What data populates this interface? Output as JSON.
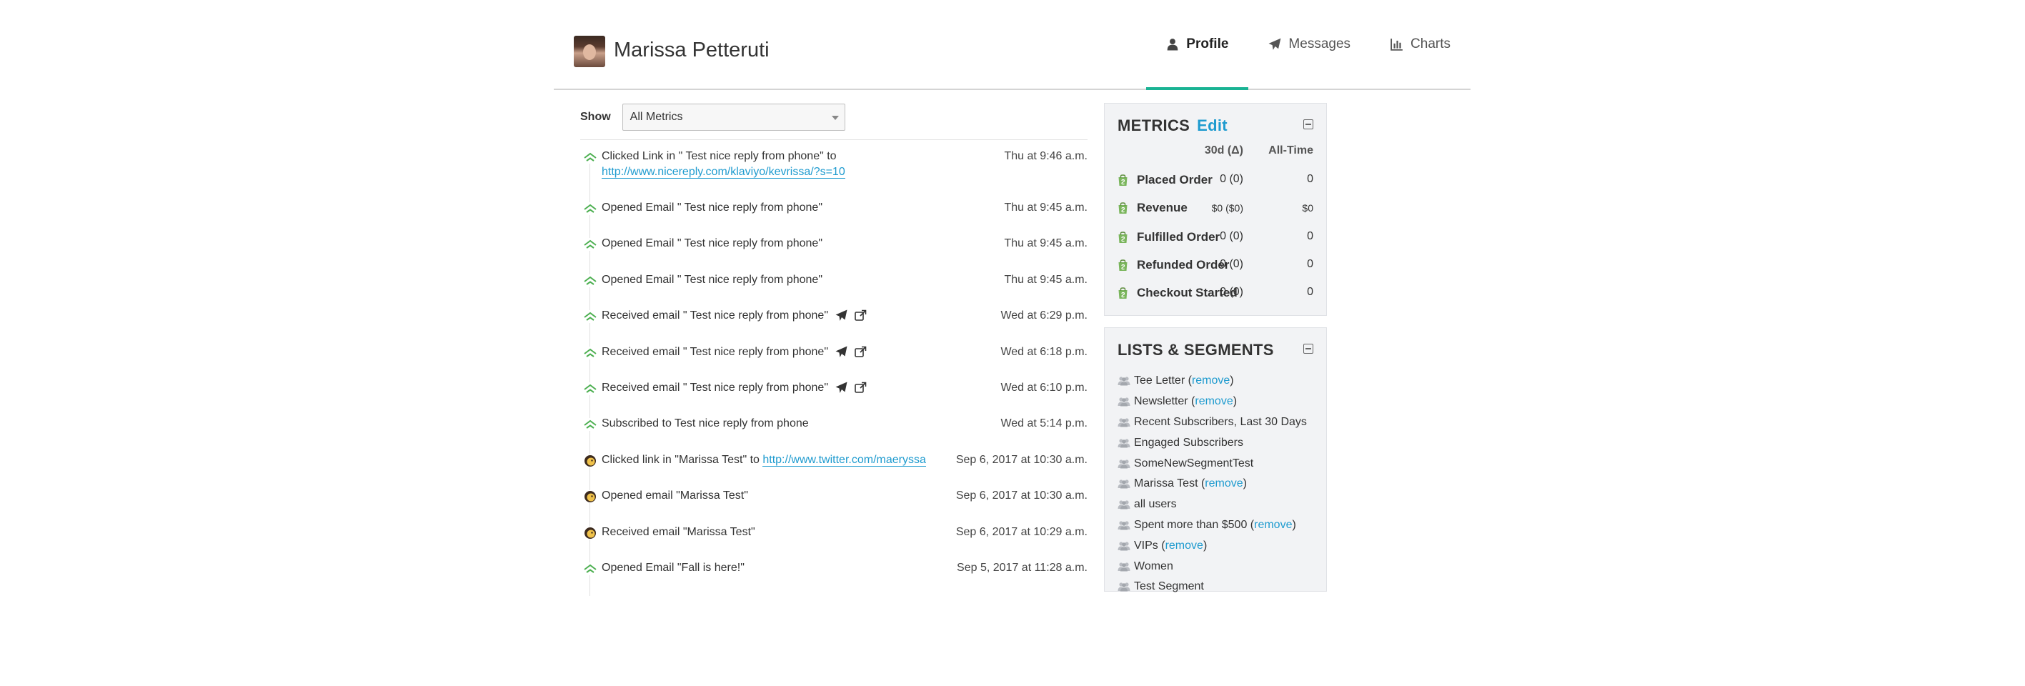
{
  "header": {
    "name": "Marissa Petteruti",
    "tabs": [
      {
        "label": "Profile",
        "icon": "user-icon",
        "active": true
      },
      {
        "label": "Messages",
        "icon": "paper-plane-icon",
        "active": false
      },
      {
        "label": "Charts",
        "icon": "bar-chart-icon",
        "active": false
      }
    ]
  },
  "filter": {
    "label": "Show",
    "value": "All Metrics"
  },
  "events": [
    {
      "text": "Clicked Link in \" Test nice reply from phone\" to ",
      "link": "http://www.nicereply.com/klaviyo/kevrissa/?s=10",
      "time": "Thu at 9:46 a.m.",
      "icon": "klaviyo-icon"
    },
    {
      "text": "Opened Email \" Test nice reply from phone\"",
      "time": "Thu at 9:45 a.m.",
      "icon": "klaviyo-icon"
    },
    {
      "text": "Opened Email \" Test nice reply from phone\"",
      "time": "Thu at 9:45 a.m.",
      "icon": "klaviyo-icon"
    },
    {
      "text": "Opened Email \" Test nice reply from phone\"",
      "time": "Thu at 9:45 a.m.",
      "icon": "klaviyo-icon"
    },
    {
      "text": "Received email \" Test nice reply from phone\"",
      "time": "Wed at 6:29 p.m.",
      "icon": "klaviyo-icon",
      "actions": true
    },
    {
      "text": "Received email \" Test nice reply from phone\"",
      "time": "Wed at 6:18 p.m.",
      "icon": "klaviyo-icon",
      "actions": true
    },
    {
      "text": "Received email \" Test nice reply from phone\"",
      "time": "Wed at 6:10 p.m.",
      "icon": "klaviyo-icon",
      "actions": true
    },
    {
      "text": "Subscribed to Test nice reply from phone",
      "time": "Wed at 5:14 p.m.",
      "icon": "klaviyo-icon"
    },
    {
      "text": "Clicked link in \"Marissa Test\" to ",
      "link": "http://www.twitter.com/maeryssa",
      "time": "Sep 6, 2017 at 10:30 a.m.",
      "icon": "mailchimp-icon"
    },
    {
      "text": "Opened email \"Marissa Test\"",
      "time": "Sep 6, 2017 at 10:30 a.m.",
      "icon": "mailchimp-icon"
    },
    {
      "text": "Received email \"Marissa Test\"",
      "time": "Sep 6, 2017 at 10:29 a.m.",
      "icon": "mailchimp-icon"
    },
    {
      "text": "Opened Email \"Fall is here!\"",
      "time": "Sep 5, 2017 at 11:28 a.m.",
      "icon": "klaviyo-icon"
    }
  ],
  "metrics": {
    "title": "METRICS",
    "edit_label": "Edit",
    "col_30d": "30d (Δ)",
    "col_all": "All-Time",
    "rows": [
      {
        "name": "Placed Order",
        "d30": "0 (0)",
        "all": "0",
        "small": false
      },
      {
        "name": "Revenue",
        "d30": "$0 ($0)",
        "all": "$0",
        "small": true
      },
      {
        "name": "Fulfilled Order",
        "d30": "0 (0)",
        "all": "0",
        "small": false
      },
      {
        "name": "Refunded Order",
        "d30": "0 (0)",
        "all": "0",
        "small": false
      },
      {
        "name": "Checkout Started",
        "d30": "0 (0)",
        "all": "0",
        "small": false
      }
    ]
  },
  "lists": {
    "title": "LISTS & SEGMENTS",
    "remove_label": "remove",
    "items": [
      {
        "name": "Tee Letter",
        "removable": true
      },
      {
        "name": "Newsletter",
        "removable": true
      },
      {
        "name": "Recent Subscribers, Last 30 Days",
        "removable": false
      },
      {
        "name": "Engaged Subscribers",
        "removable": false
      },
      {
        "name": "SomeNewSegmentTest",
        "removable": false
      },
      {
        "name": "Marissa Test",
        "removable": true
      },
      {
        "name": "all users",
        "removable": false
      },
      {
        "name": "Spent more than $500",
        "removable": true
      },
      {
        "name": "VIPs",
        "removable": true
      },
      {
        "name": "Women",
        "removable": false
      },
      {
        "name": "Test Segment",
        "removable": false
      }
    ]
  },
  "colors": {
    "accent": "#1ab394",
    "link": "#1f9bcf",
    "klaviyo": "#4caf50",
    "shopify": "#7ab55c"
  }
}
